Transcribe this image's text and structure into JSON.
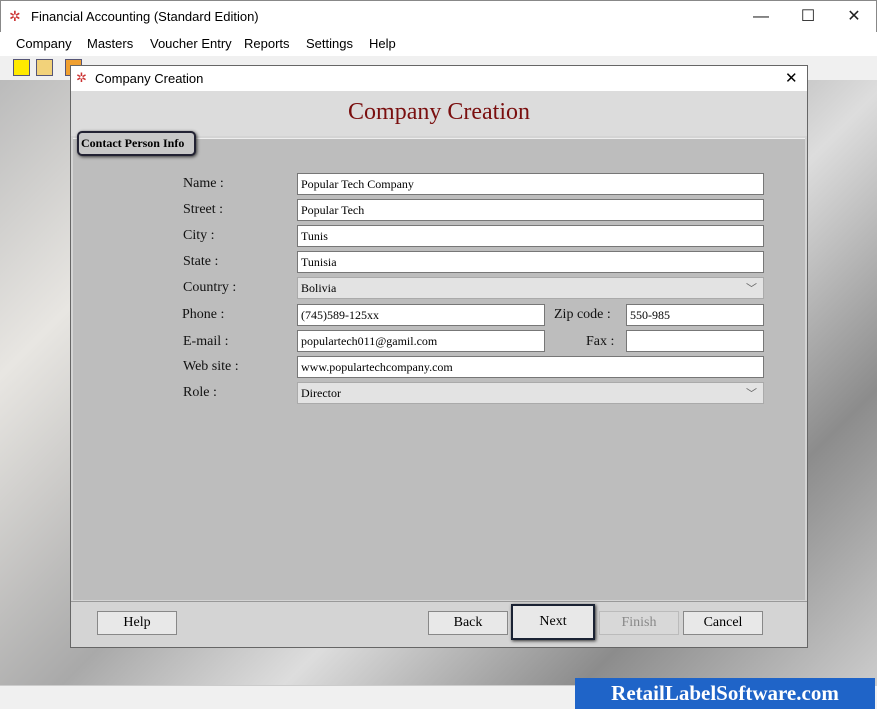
{
  "app": {
    "title": "Financial Accounting (Standard Edition)",
    "minimize": "—",
    "maximize": "☐",
    "close": "✕"
  },
  "menu": [
    "Company",
    "Masters",
    "Voucher Entry",
    "Reports",
    "Settings",
    "Help"
  ],
  "dialog": {
    "title": "Company Creation",
    "close": "✕",
    "header": "Company Creation",
    "group": "Contact Person Info"
  },
  "form": {
    "name": {
      "label": "Name :",
      "value": "Popular Tech Company"
    },
    "street": {
      "label": "Street :",
      "value": "Popular Tech"
    },
    "city": {
      "label": "City :",
      "value": "Tunis"
    },
    "state": {
      "label": "State :",
      "value": "Tunisia"
    },
    "country": {
      "label": "Country :",
      "value": "Bolivia"
    },
    "phone": {
      "label": "Phone :",
      "value": "(745)589-125xx"
    },
    "zip": {
      "label": "Zip code :",
      "value": "550-985"
    },
    "email": {
      "label": "E-mail :",
      "value": "populartech011@gamil.com"
    },
    "fax": {
      "label": "Fax :",
      "value": ""
    },
    "website": {
      "label": "Web site :",
      "value": "www.populartechcompany.com"
    },
    "role": {
      "label": "Role :",
      "value": "Director"
    }
  },
  "buttons": {
    "help": "Help",
    "back": "Back",
    "next": "Next",
    "finish": "Finish",
    "cancel": "Cancel"
  },
  "watermark": "RetailLabelSoftware.com",
  "colors": {
    "header_text": "#7a0f0f",
    "banner": "#1f64c8"
  }
}
